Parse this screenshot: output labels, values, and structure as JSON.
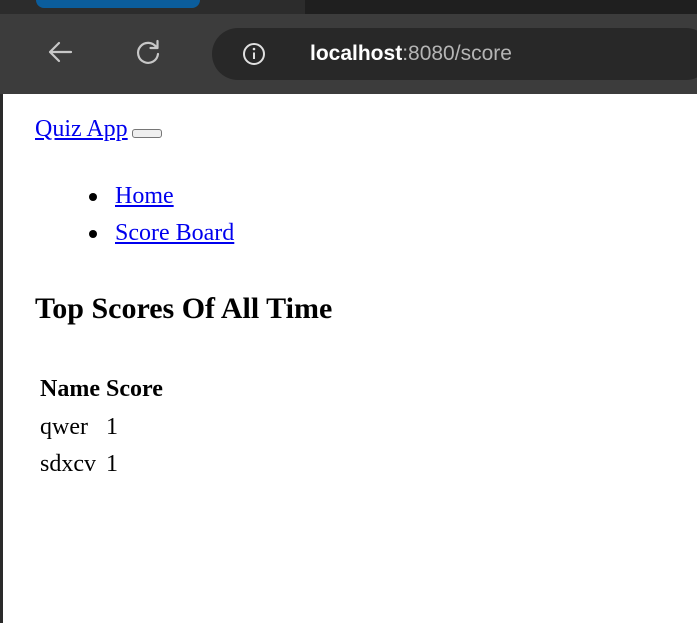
{
  "browser": {
    "url_host": "localhost",
    "url_rest": ":8080/score",
    "icons": {
      "back": "back-arrow-icon",
      "reload": "reload-icon",
      "site_info": "info-icon"
    }
  },
  "navbar": {
    "brand": "Quiz App",
    "toggler_icon": "navbar-toggler-icon",
    "links": [
      {
        "label": "Home"
      },
      {
        "label": "Score Board"
      }
    ]
  },
  "page": {
    "heading": "Top Scores Of All Time"
  },
  "table": {
    "headers": [
      "Name",
      "Score"
    ],
    "rows": [
      {
        "name": "qwer",
        "score": "1"
      },
      {
        "name": "sdxcv",
        "score": "1"
      }
    ]
  },
  "colors": {
    "link": "#0000ee",
    "toolbar": "#3c3c3c",
    "omnibox": "#282828",
    "tab_accent": "#0b5d9c"
  }
}
